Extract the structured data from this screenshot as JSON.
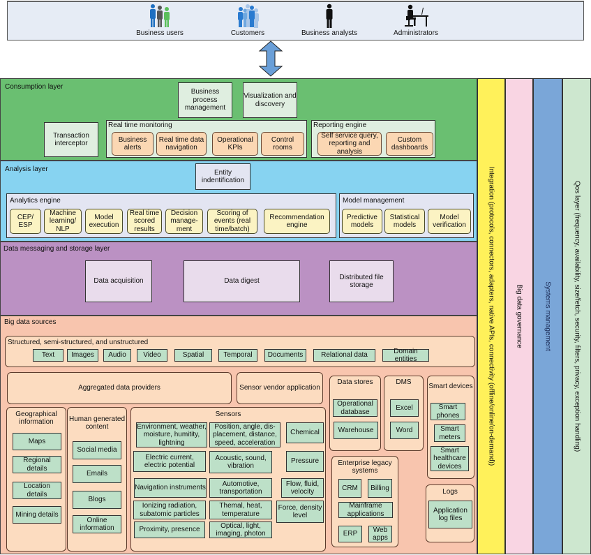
{
  "users": [
    {
      "label": "Business users",
      "icon": "business-users-icon"
    },
    {
      "label": "Customers",
      "icon": "customers-icon"
    },
    {
      "label": "Business analysts",
      "icon": "business-analyst-icon"
    },
    {
      "label": "Administrators",
      "icon": "administrator-icon"
    }
  ],
  "colors": {
    "consumption": "#6abf71",
    "analysis": "#87d3f1",
    "messaging": "#bb91c3",
    "sources": "#f8c5ae",
    "integration": "#fff15a",
    "governance": "#f9d5e3",
    "systems": "#7aa6d8",
    "qos": "#cde7cf",
    "arrow": "#6a9fd8"
  },
  "consumption": {
    "title": "Consumption layer",
    "bpm": "Business process management",
    "visualization": "Visualization and discovery",
    "transaction": "Transaction interceptor",
    "rtm": {
      "title": "Real time monitoring",
      "items": [
        "Business alerts",
        "Real time data navigation",
        "Operational KPIs",
        "Control rooms"
      ]
    },
    "reporting": {
      "title": "Reporting engine",
      "items": [
        "Self service query, reporting and analysis",
        "Custom dashboards"
      ]
    }
  },
  "analysis": {
    "title": "Analysis layer",
    "entity": "Entity indentification",
    "engine": {
      "title": "Analytics engine",
      "items": [
        "CEP/ ESP",
        "Machine learning/ NLP",
        "Model execution",
        "Real time scored results",
        "Decision manage-ment",
        "Scoring of events (real time/batch)",
        "Recommendation engine"
      ]
    },
    "model": {
      "title": "Model management",
      "items": [
        "Predictive models",
        "Statistical models",
        "Model verification"
      ]
    }
  },
  "messaging": {
    "title": "Data messaging and storage layer",
    "items": [
      "Data acquisition",
      "Data digest",
      "Distributed file storage"
    ]
  },
  "sources": {
    "title": "Big data sources",
    "structured": {
      "title": "Structured, semi-structured, and unstructured",
      "items": [
        "Text",
        "Images",
        "Audio",
        "Video",
        "Spatial",
        "Temporal",
        "Documents",
        "Relational data",
        "Domain entities"
      ]
    },
    "aggregated": "Aggregated data providers",
    "sensor_vendor": "Sensor vendor application",
    "geo": {
      "title": "Geographical information",
      "items": [
        "Maps",
        "Regional details",
        "Location details",
        "Mining details"
      ]
    },
    "human": {
      "title": "Human generated content",
      "items": [
        "Social media",
        "Emails",
        "Blogs",
        "Online information"
      ]
    },
    "sensors": {
      "title": "Sensors",
      "items": [
        "Environment, weather, moisture, humitity, lightning",
        "Position, angle, dis-placement, distance, speed, acceleration",
        "Chemical",
        "Electric current, electric potential",
        "Acoustic, sound, vibration",
        "Pressure",
        "Navigation instruments",
        "Automotive, transportation",
        "Flow, fluid, velocity",
        "Ionizing radiation, subatomic particles",
        "Themal, heat, temperature",
        "Force, density level",
        "Proximity, presence",
        "Optical, light, imaging, photon"
      ]
    },
    "datastores": {
      "title": "Data stores",
      "items": [
        "Operational database",
        "Warehouse"
      ]
    },
    "dms": {
      "title": "DMS",
      "items": [
        "Excel",
        "Word"
      ]
    },
    "smart": {
      "title": "Smart devices",
      "items": [
        "Smart phones",
        "Smart meters",
        "Smart healthcare devices"
      ]
    },
    "legacy": {
      "title": "Enterprise legacy systems",
      "items": [
        "CRM",
        "Billing",
        "Mainframe applications",
        "ERP",
        "Web apps"
      ]
    },
    "logs": {
      "title": "Logs",
      "items": [
        "Application log files"
      ]
    }
  },
  "vertical": [
    "Integration (protocols, connectors, adapters, native APIs, connectivity (offline/online/on-demand))",
    "Big data governance",
    "Systems management",
    "Qos layer (frequency, availability, size/fetch, security, filters, privacy, exception handling)"
  ]
}
